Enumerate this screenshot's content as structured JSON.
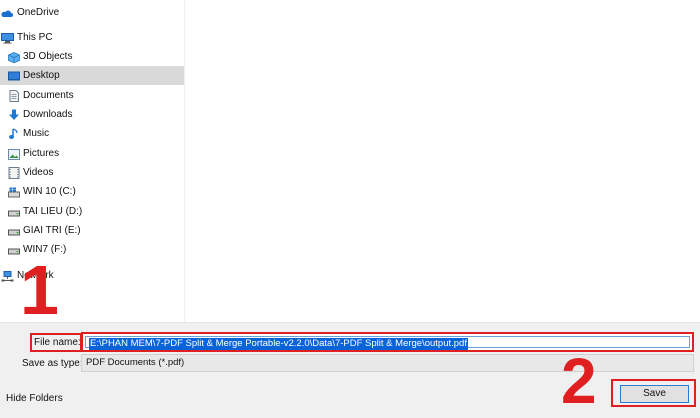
{
  "nav": {
    "items": [
      {
        "label": "OneDrive",
        "icon": "cloud-icon"
      },
      {
        "label": "This PC",
        "icon": "computer-icon"
      },
      {
        "label": "3D Objects",
        "icon": "cube-icon"
      },
      {
        "label": "Desktop",
        "icon": "desktop-folder-icon"
      },
      {
        "label": "Documents",
        "icon": "document-icon"
      },
      {
        "label": "Downloads",
        "icon": "download-arrow-icon"
      },
      {
        "label": "Music",
        "icon": "music-note-icon"
      },
      {
        "label": "Pictures",
        "icon": "picture-icon"
      },
      {
        "label": "Videos",
        "icon": "video-icon"
      },
      {
        "label": "WIN 10 (C:)",
        "icon": "windows-drive-icon"
      },
      {
        "label": "TAI LIEU (D:)",
        "icon": "drive-icon"
      },
      {
        "label": "GIAI TRI (E:)",
        "icon": "drive-icon"
      },
      {
        "label": "WIN7 (F:)",
        "icon": "drive-icon"
      },
      {
        "label": "Network",
        "icon": "network-icon"
      }
    ],
    "selected": "Desktop"
  },
  "form": {
    "file_name_label": "File name:",
    "file_name_value": "E:\\PHAN MEM\\7-PDF Split & Merge Portable-v2.2.0\\Data\\7-PDF Split & Merge\\output.pdf",
    "save_as_type_label": "Save as type:",
    "save_as_type_value": "PDF Documents (*.pdf)"
  },
  "footer": {
    "hide_folders_label": "Hide Folders",
    "save_label": "Save"
  },
  "annotations": {
    "step1": "1",
    "step2": "2",
    "color": "#e02020"
  }
}
